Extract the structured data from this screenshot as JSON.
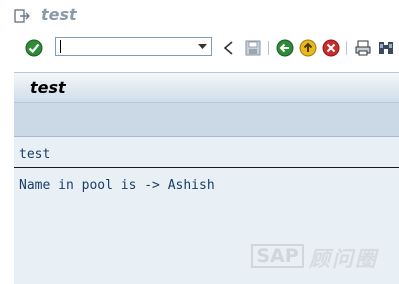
{
  "window": {
    "title": "test"
  },
  "toolbar": {
    "command_value": "",
    "command_placeholder": ""
  },
  "screen": {
    "header_title": "test",
    "list_title": "test",
    "output_line": "Name in pool is -> Ashish"
  },
  "watermark": {
    "brand": "SAP",
    "text": "顾问圈"
  },
  "colors": {
    "title_text": "#8a9aaa",
    "list_text": "#1a3f66",
    "content_bg": "#e8eff5",
    "header_band": "#cbd9e6"
  }
}
